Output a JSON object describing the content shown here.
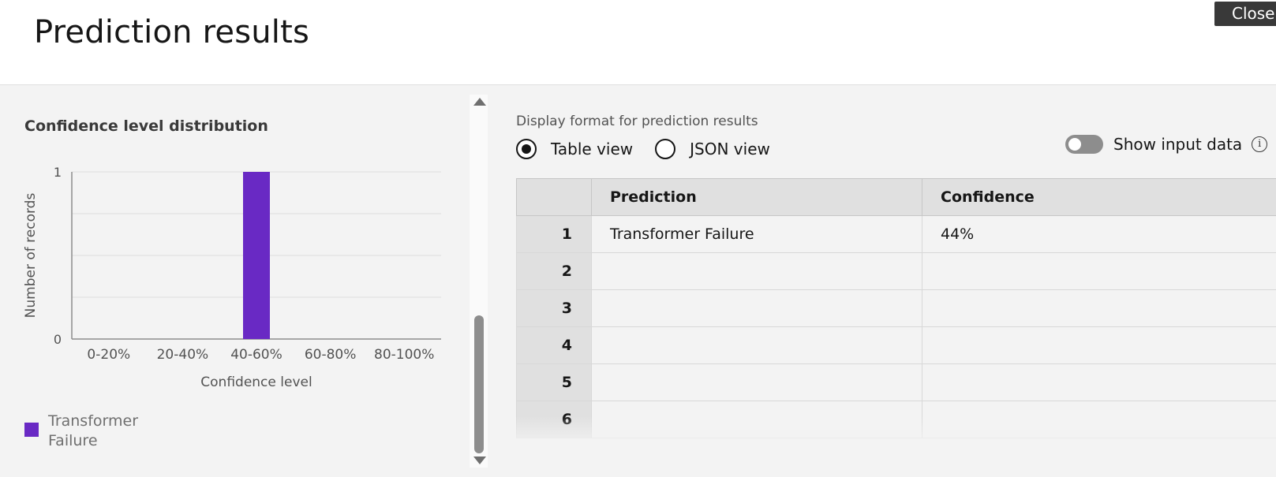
{
  "window": {
    "title": "Prediction results",
    "close_label": "Close"
  },
  "chart_panel": {
    "title": "Confidence level distribution",
    "legend": [
      {
        "label_line1": "Transformer",
        "label_line2": "Failure",
        "color": "#6929c4"
      }
    ]
  },
  "chart_data": {
    "type": "bar",
    "categories": [
      "0-20%",
      "20-40%",
      "40-60%",
      "60-80%",
      "80-100%"
    ],
    "series": [
      {
        "name": "Transformer Failure",
        "values": [
          0,
          0,
          1,
          0,
          0
        ],
        "color": "#6929c4"
      }
    ],
    "xlabel": "Confidence level",
    "ylabel": "Number of records",
    "ylim": [
      0,
      1
    ],
    "yticks": [
      "0",
      "1"
    ],
    "grid": true
  },
  "results_panel": {
    "format_label": "Display format for prediction results",
    "views": [
      {
        "label": "Table view",
        "selected": true
      },
      {
        "label": "JSON view",
        "selected": false
      }
    ],
    "show_input_toggle": {
      "label": "Show input data",
      "on": false
    },
    "table": {
      "columns": [
        "Prediction",
        "Confidence"
      ],
      "rows": [
        {
          "index": "1",
          "prediction": "Transformer Failure",
          "confidence": "44%"
        },
        {
          "index": "2",
          "prediction": "",
          "confidence": ""
        },
        {
          "index": "3",
          "prediction": "",
          "confidence": ""
        },
        {
          "index": "4",
          "prediction": "",
          "confidence": ""
        },
        {
          "index": "5",
          "prediction": "",
          "confidence": ""
        },
        {
          "index": "6",
          "prediction": "",
          "confidence": ""
        }
      ]
    }
  }
}
